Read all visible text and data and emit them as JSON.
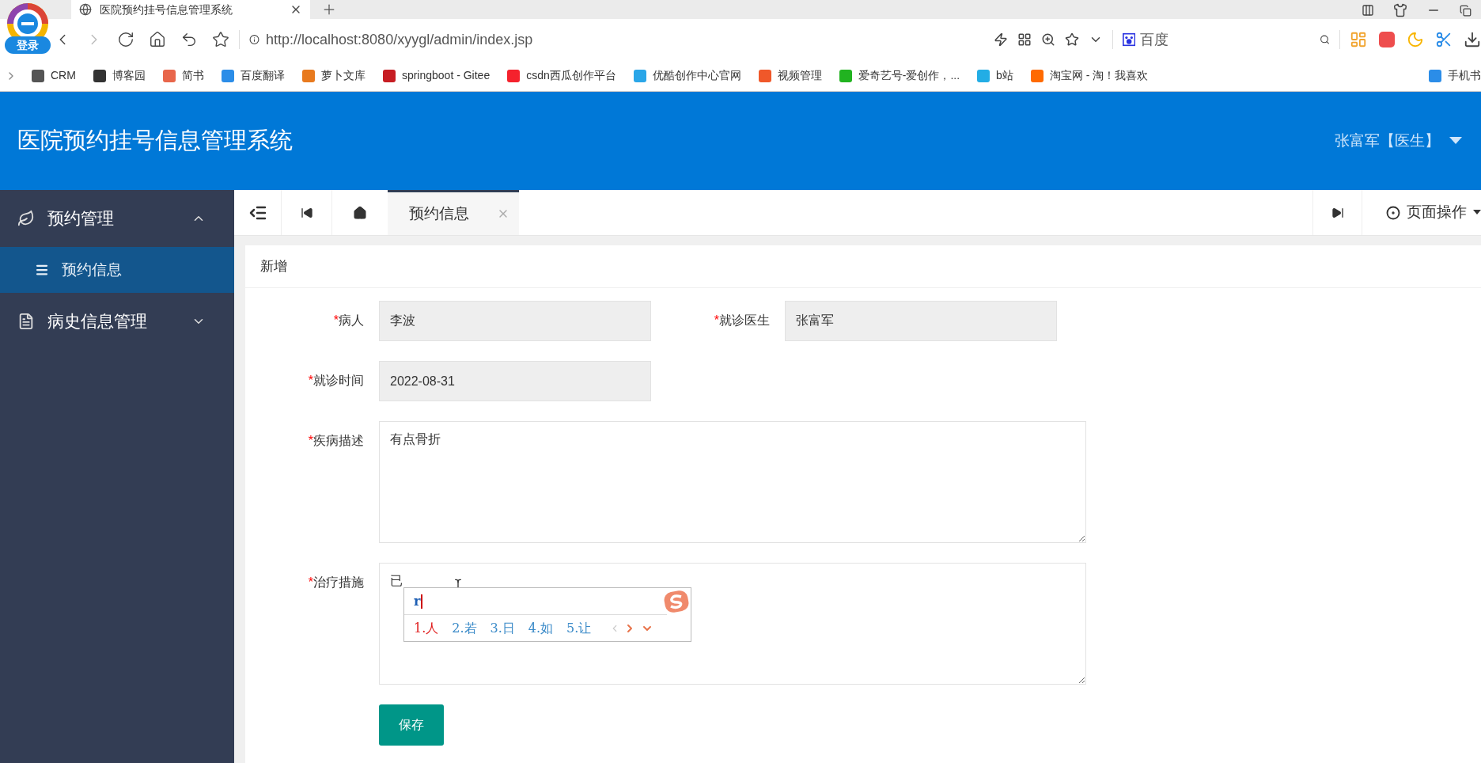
{
  "browser": {
    "login_badge": "登录",
    "tab_title": "医院预约挂号信息管理系统",
    "address": "http://localhost:8080/xyygl/admin/index.jsp",
    "search_engine": "百度",
    "bookmarks": [
      {
        "label": "CRM",
        "color": "#555555"
      },
      {
        "label": "博客园",
        "color": "#333333"
      },
      {
        "label": "简书",
        "color": "#e8664b"
      },
      {
        "label": "百度翻译",
        "color": "#2b8de8"
      },
      {
        "label": "萝卜文库",
        "color": "#e87a1e"
      },
      {
        "label": "springboot - Gitee",
        "color": "#c71d23"
      },
      {
        "label": "csdn西瓜创作平台",
        "color": "#f5222d"
      },
      {
        "label": "优酷创作中心官网",
        "color": "#2aa6e8"
      },
      {
        "label": "视频管理",
        "color": "#f0582a"
      },
      {
        "label": "爱奇艺号-爱创作，...",
        "color": "#21b320"
      },
      {
        "label": "b站",
        "color": "#23ade5"
      },
      {
        "label": "淘宝网 - 淘！我喜欢",
        "color": "#ff6a00"
      },
      {
        "label": "手机书",
        "color": "#2b8de8"
      }
    ]
  },
  "header": {
    "title": "医院预约挂号信息管理系统",
    "user": "张富军【医生】"
  },
  "sidebar": {
    "items": [
      {
        "label": "预约管理",
        "expanded": true,
        "children": [
          {
            "label": "预约信息",
            "selected": true
          }
        ]
      },
      {
        "label": "病史信息管理",
        "expanded": false
      }
    ]
  },
  "tabs_bar": {
    "tabs": [
      {
        "label": "预约信息",
        "selected": true
      }
    ],
    "page_ops": "页面操作"
  },
  "form": {
    "title": "新增",
    "rows": [
      [
        {
          "mark": "*",
          "label": "病人",
          "value": "李波",
          "kind": "input",
          "disabled": true
        },
        {
          "mark": "*",
          "label": "就诊医生",
          "value": "张富军",
          "kind": "input",
          "disabled": true
        }
      ],
      [
        {
          "mark": "*",
          "label": "就诊时间",
          "value": "2022-08-31",
          "kind": "input",
          "disabled": true
        }
      ],
      [
        {
          "mark": "*",
          "label": "疾病描述",
          "value": "有点骨折",
          "kind": "textarea",
          "disabled": false
        }
      ],
      [
        {
          "mark": "*",
          "label": "治疗措施",
          "value": "已",
          "kind": "textarea",
          "disabled": false
        }
      ]
    ],
    "save": "保存"
  },
  "ime": {
    "input": "r",
    "candidates": [
      {
        "label": "1.人",
        "selected": true
      },
      {
        "label": "2.若",
        "selected": false
      },
      {
        "label": "3.日",
        "selected": false
      },
      {
        "label": "4.如",
        "selected": false
      },
      {
        "label": "5.让",
        "selected": false
      }
    ]
  }
}
